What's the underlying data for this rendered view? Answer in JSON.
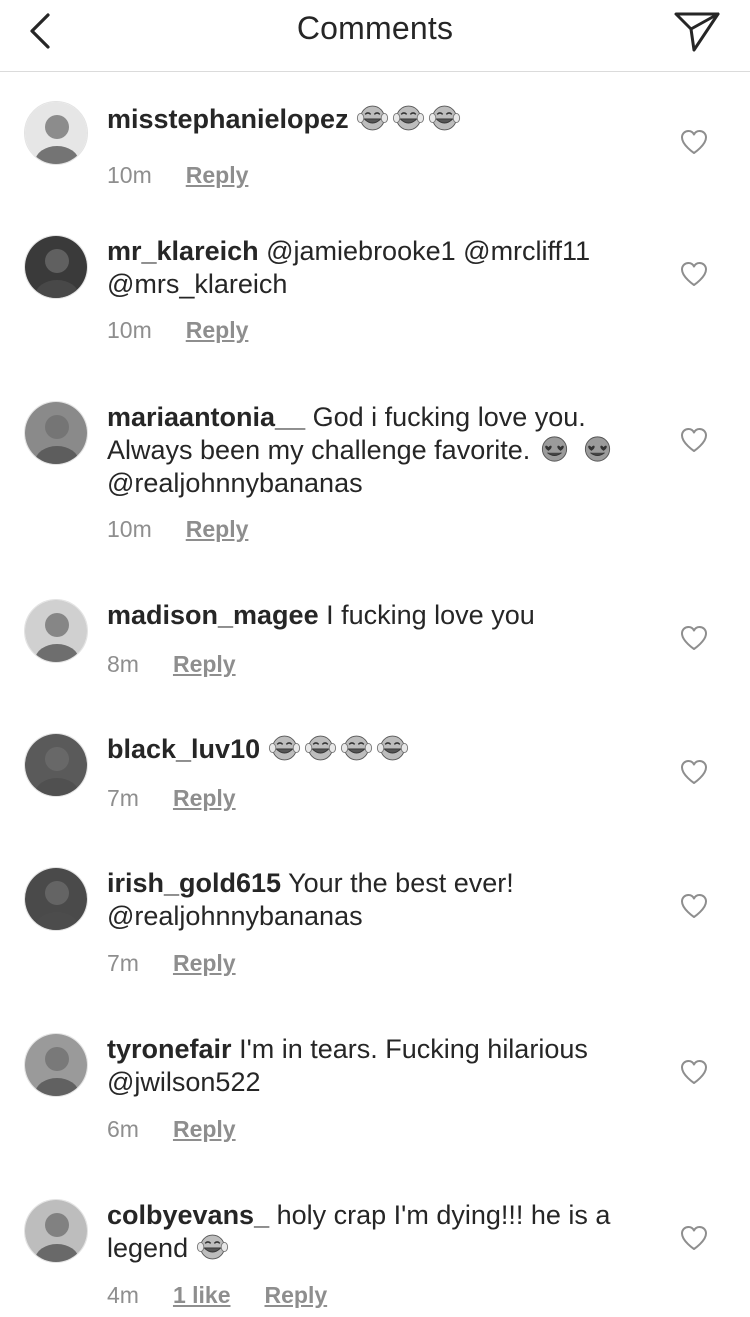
{
  "header": {
    "title": "Comments",
    "back_icon": "chevron-left-icon",
    "send_icon": "paper-plane-icon"
  },
  "colors": {
    "text": "#262626",
    "meta": "#8e8e8e",
    "divider": "#dbdbdb"
  },
  "comments": [
    {
      "username": "misstephanielopez",
      "text": "",
      "emoji": [
        "laugh-cry",
        "laugh-cry",
        "laugh-cry"
      ],
      "emoji_line2": [],
      "text_after": "",
      "time": "10m",
      "likes": "",
      "reply": "Reply"
    },
    {
      "username": "mr_klareich",
      "text": "@jamiebrooke1 @mrcliff11 @mrs_klareich",
      "emoji": [],
      "emoji_line2": [],
      "text_after": "",
      "time": "10m",
      "likes": "",
      "reply": "Reply"
    },
    {
      "username": "mariaantonia__",
      "text": "God i fucking love you. Always been my challenge favorite.",
      "emoji": [
        "heart-eyes"
      ],
      "emoji_line2": [
        "heart-eyes"
      ],
      "text_after": "@realjohnnybananas",
      "time": "10m",
      "likes": "",
      "reply": "Reply"
    },
    {
      "username": "madison_magee",
      "text": "I fucking love you",
      "emoji": [],
      "emoji_line2": [],
      "text_after": "",
      "time": "8m",
      "likes": "",
      "reply": "Reply"
    },
    {
      "username": "black_luv10",
      "text": "",
      "emoji": [
        "laugh-cry",
        "laugh-cry",
        "laugh-cry",
        "laugh-cry"
      ],
      "emoji_line2": [],
      "text_after": "",
      "time": "7m",
      "likes": "",
      "reply": "Reply"
    },
    {
      "username": "irish_gold615",
      "text": "Your the best ever! @realjohnnybananas",
      "emoji": [],
      "emoji_line2": [],
      "text_after": "",
      "time": "7m",
      "likes": "",
      "reply": "Reply"
    },
    {
      "username": "tyronefair",
      "text": "I'm in tears. Fucking hilarious @jwilson522",
      "emoji": [],
      "emoji_line2": [],
      "text_after": "",
      "time": "6m",
      "likes": "",
      "reply": "Reply"
    },
    {
      "username": "colbyevans_",
      "text": "holy crap I'm dying!!! he is a legend",
      "emoji": [
        "laugh-cry"
      ],
      "emoji_line2": [],
      "text_after": "",
      "time": "4m",
      "likes": "1 like",
      "reply": "Reply"
    }
  ]
}
